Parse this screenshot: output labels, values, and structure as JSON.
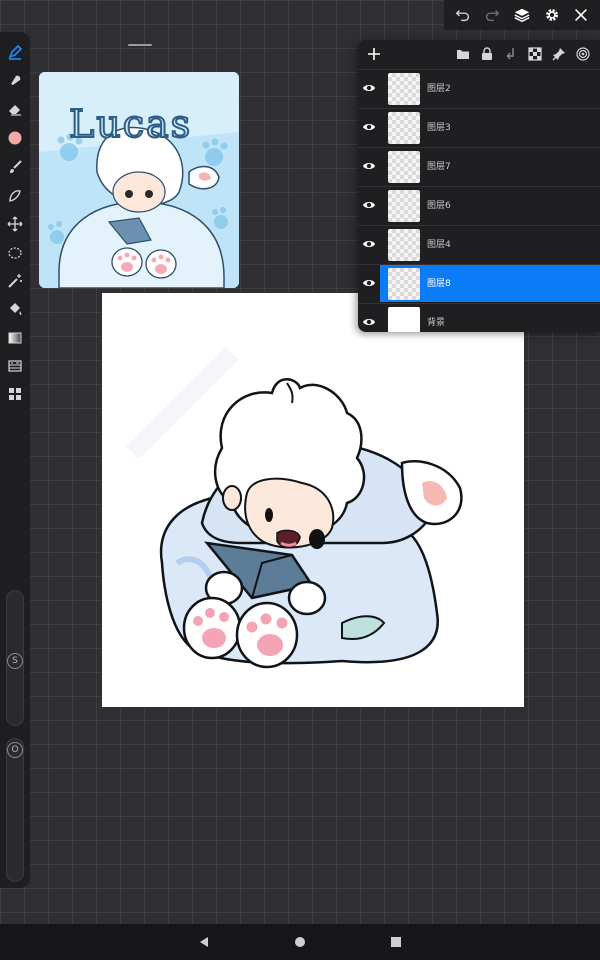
{
  "top_bar": {
    "icons": [
      "undo-icon",
      "redo-icon",
      "layers-icon",
      "settings-icon",
      "close-icon"
    ]
  },
  "tools": [
    "pen-icon",
    "smudge-icon",
    "eraser-icon",
    "color-swatch",
    "brush-icon",
    "lasso-icon",
    "transform-icon",
    "selection-icon",
    "magic-wand-icon",
    "fill-icon",
    "gradient-icon",
    "adjust-icon",
    "gallery-icon"
  ],
  "brush_color": "#f4a9a9",
  "accent_color": "#0b7cf5",
  "sliders": {
    "size_label": "S",
    "opacity_label": "O"
  },
  "reference": {
    "title": "Lucas"
  },
  "layers_panel": {
    "add_label": "+",
    "tool_icons": [
      "folder-icon",
      "lock-icon",
      "merge-icon",
      "checker-icon",
      "pin-icon",
      "target-icon"
    ],
    "layers": [
      {
        "name": "图层2",
        "visible": true,
        "selected": false
      },
      {
        "name": "图层3",
        "visible": true,
        "selected": false
      },
      {
        "name": "图层7",
        "visible": true,
        "selected": false
      },
      {
        "name": "图层6",
        "visible": true,
        "selected": false
      },
      {
        "name": "图层4",
        "visible": true,
        "selected": false
      },
      {
        "name": "图层8",
        "visible": true,
        "selected": true
      },
      {
        "name": "背景",
        "visible": true,
        "selected": false
      }
    ]
  },
  "nav": {
    "icons": [
      "back-icon",
      "home-icon",
      "recents-icon"
    ]
  }
}
